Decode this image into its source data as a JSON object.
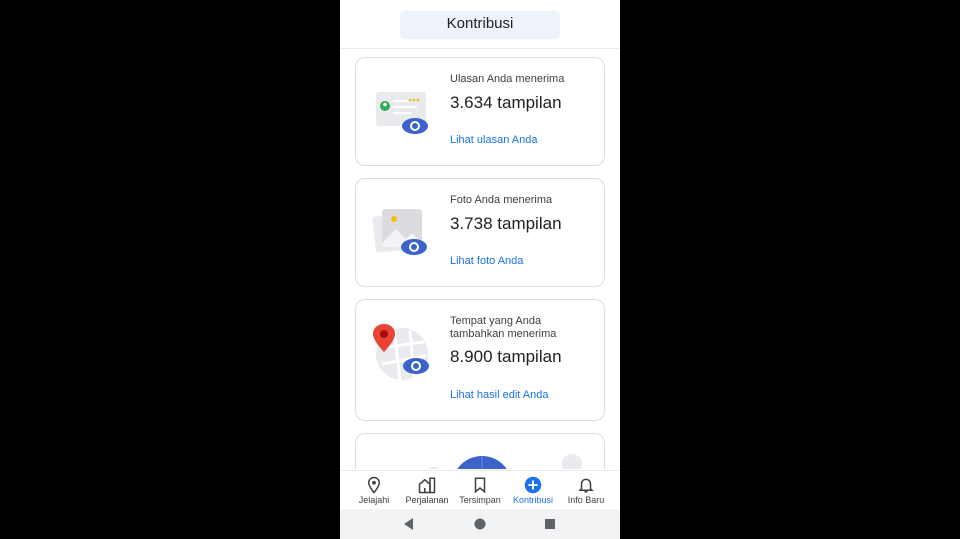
{
  "header": {
    "title": "Kontribusi"
  },
  "cards": [
    {
      "label": "Ulasan Anda menerima",
      "value": "3.634 tampilan",
      "link": "Lihat ulasan Anda",
      "illustration": "review-card-eye-icon"
    },
    {
      "label": "Foto Anda menerima",
      "value": "3.738 tampilan",
      "link": "Lihat foto Anda",
      "illustration": "photo-eye-icon"
    },
    {
      "label": "Tempat yang Anda tambahkan menerima",
      "value": "8.900 tampilan",
      "link": "Lihat hasil edit Anda",
      "illustration": "map-pin-eye-icon"
    }
  ],
  "nav": [
    {
      "label": "Jelajahi",
      "icon": "location-pin-icon",
      "active": false
    },
    {
      "label": "Perjalanan",
      "icon": "commute-icon",
      "active": false
    },
    {
      "label": "Tersimpan",
      "icon": "bookmark-icon",
      "active": false
    },
    {
      "label": "Kontribusi",
      "icon": "add-circle-icon",
      "active": true
    },
    {
      "label": "Info Baru",
      "icon": "bell-icon",
      "active": false
    }
  ],
  "system_nav": [
    "back-icon",
    "home-icon",
    "recents-icon"
  ],
  "colors": {
    "accent": "#1a73e8",
    "eye": "#3c63c9",
    "pin": "#ea4335"
  }
}
